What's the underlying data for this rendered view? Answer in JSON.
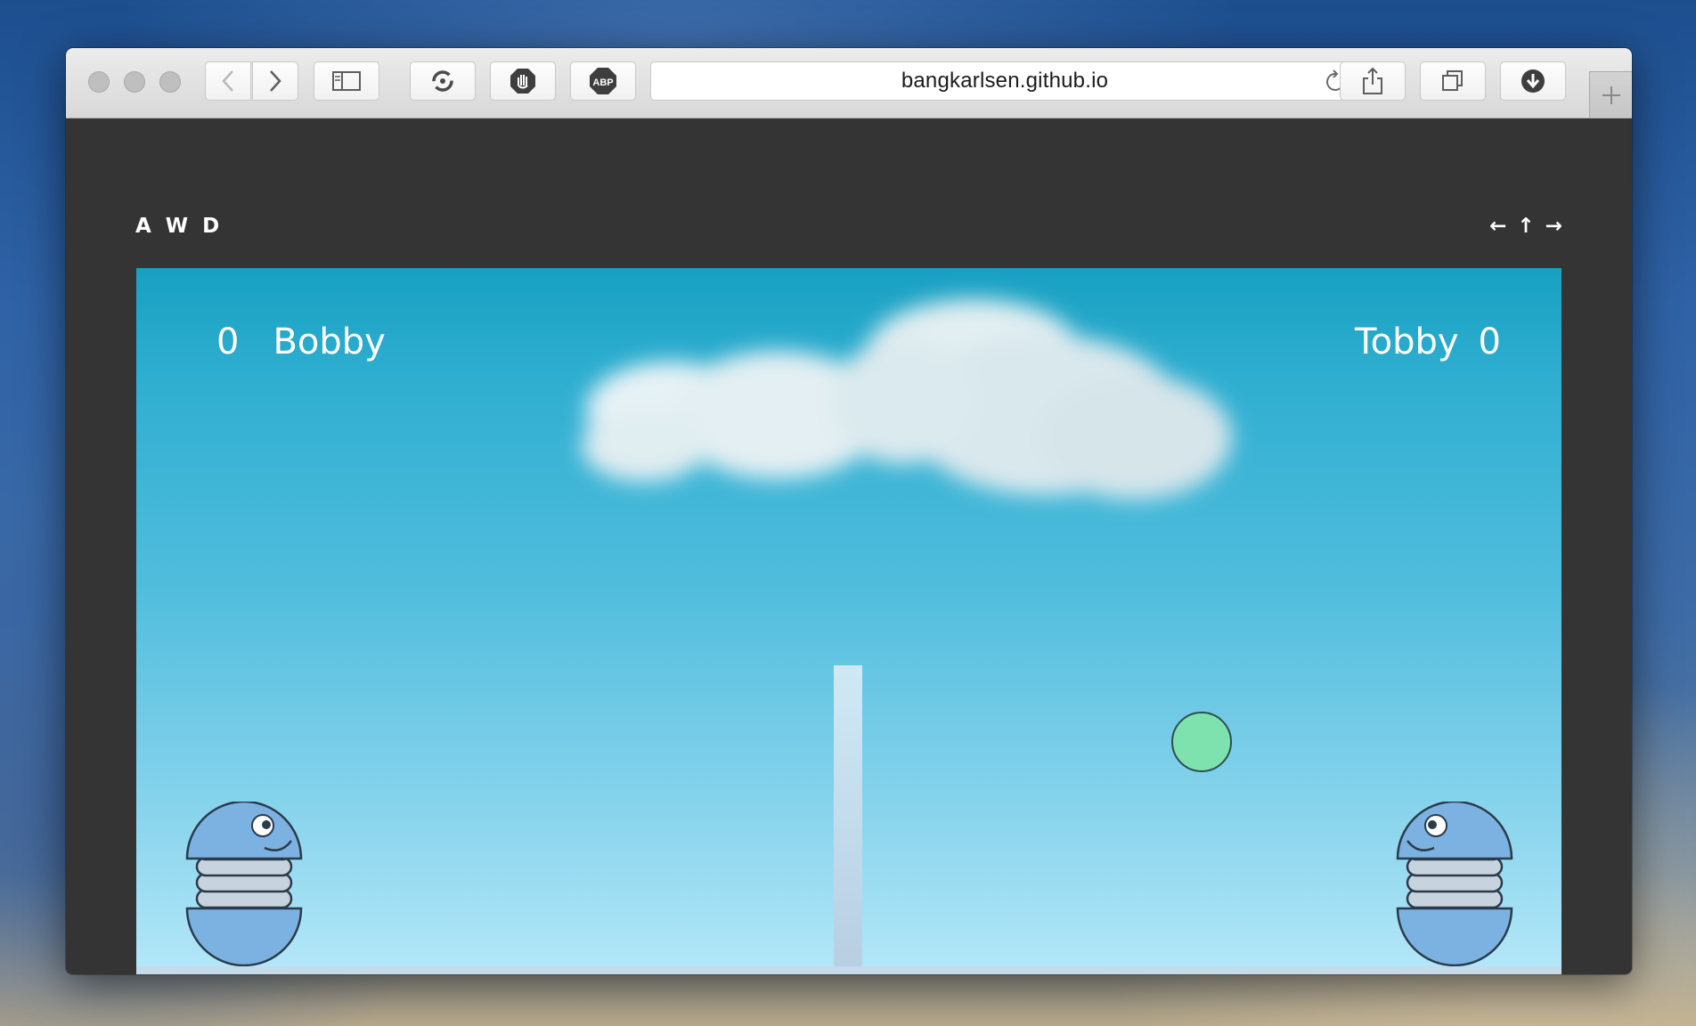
{
  "browser": {
    "url": "bangkarlsen.github.io",
    "buttons": [
      "back",
      "forward",
      "sidebar",
      "refresh-extension",
      "stop-extension",
      "adblock",
      "reload",
      "share",
      "tabs",
      "downloads",
      "new-tab"
    ],
    "adblock_label": "ABP"
  },
  "game": {
    "controls_left": "A W D",
    "controls_right": "← ↑ →",
    "player1": {
      "name": "Bobby",
      "score": "0"
    },
    "player2": {
      "name": "Tobby",
      "score": "0"
    }
  },
  "colors": {
    "sky_top": "#18a0c2",
    "sky_bottom": "#b6e8f9",
    "ball": "#7de2ad",
    "player": "#7cb2e2",
    "player_spring": "#c7d3df",
    "net": "#cfe9f4",
    "page_bg": "#343434"
  }
}
